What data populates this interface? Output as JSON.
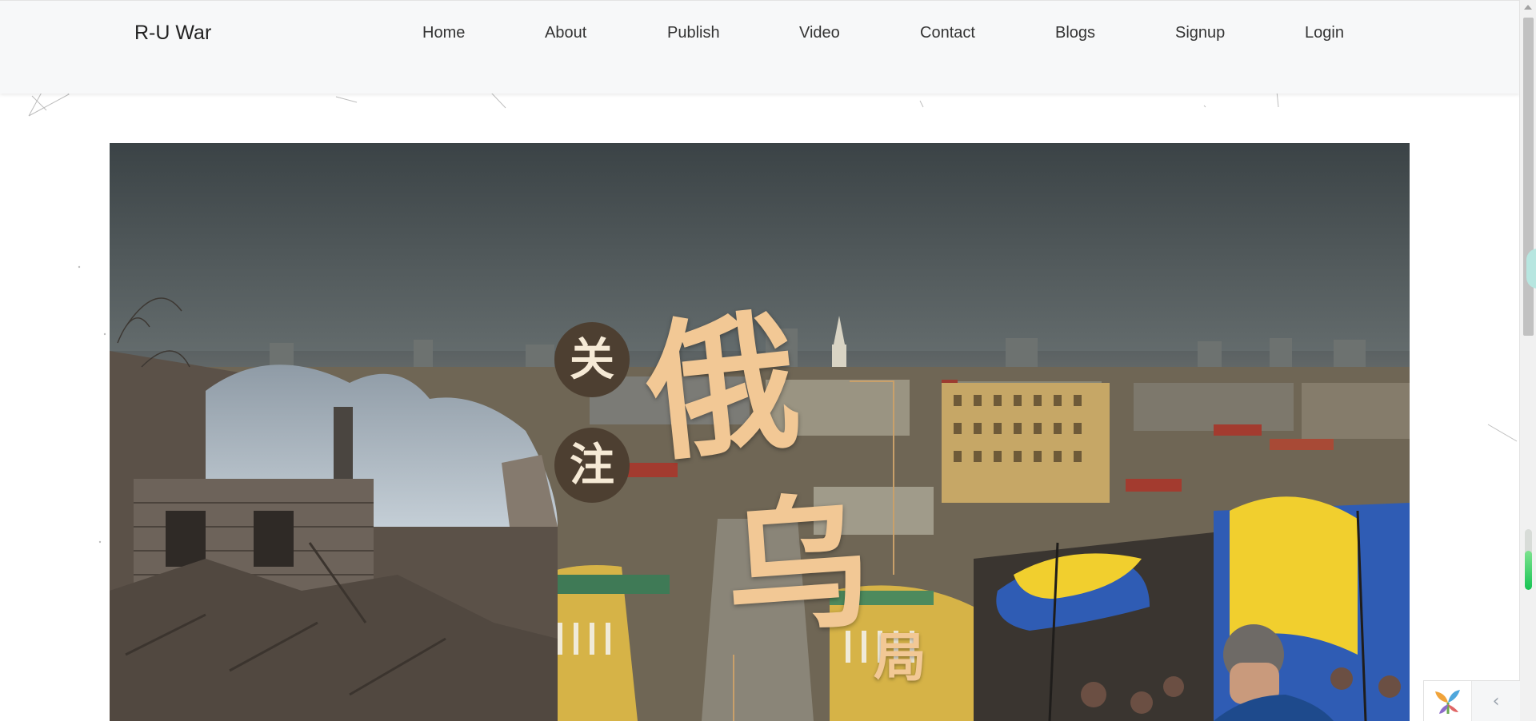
{
  "navbar": {
    "brand": "R-U War",
    "links": [
      "Home",
      "About",
      "Publish",
      "Video",
      "Contact",
      "Blogs",
      "Signup",
      "Login"
    ]
  },
  "banner": {
    "badges": [
      "关",
      "注"
    ],
    "title_chars": [
      "俄",
      "乌"
    ],
    "side_char": "局",
    "colors": {
      "calligraphy": "#f2c895",
      "badge_bg": "#4d3f31",
      "badge_text": "#f6ead6",
      "frame_line": "#c9a06a",
      "flag_blue": "#2f5cb4",
      "flag_yellow": "#f1cf2e"
    }
  },
  "widgets": {
    "side_progress_percent": 65,
    "logo_icon": "colorful-leaf-logo-icon",
    "collapse_icon": "chevron-left-icon",
    "collapse_glyph": "‹"
  },
  "colors": {
    "navbar_bg": "#f7f8f9",
    "progress_green": "#16c454"
  }
}
